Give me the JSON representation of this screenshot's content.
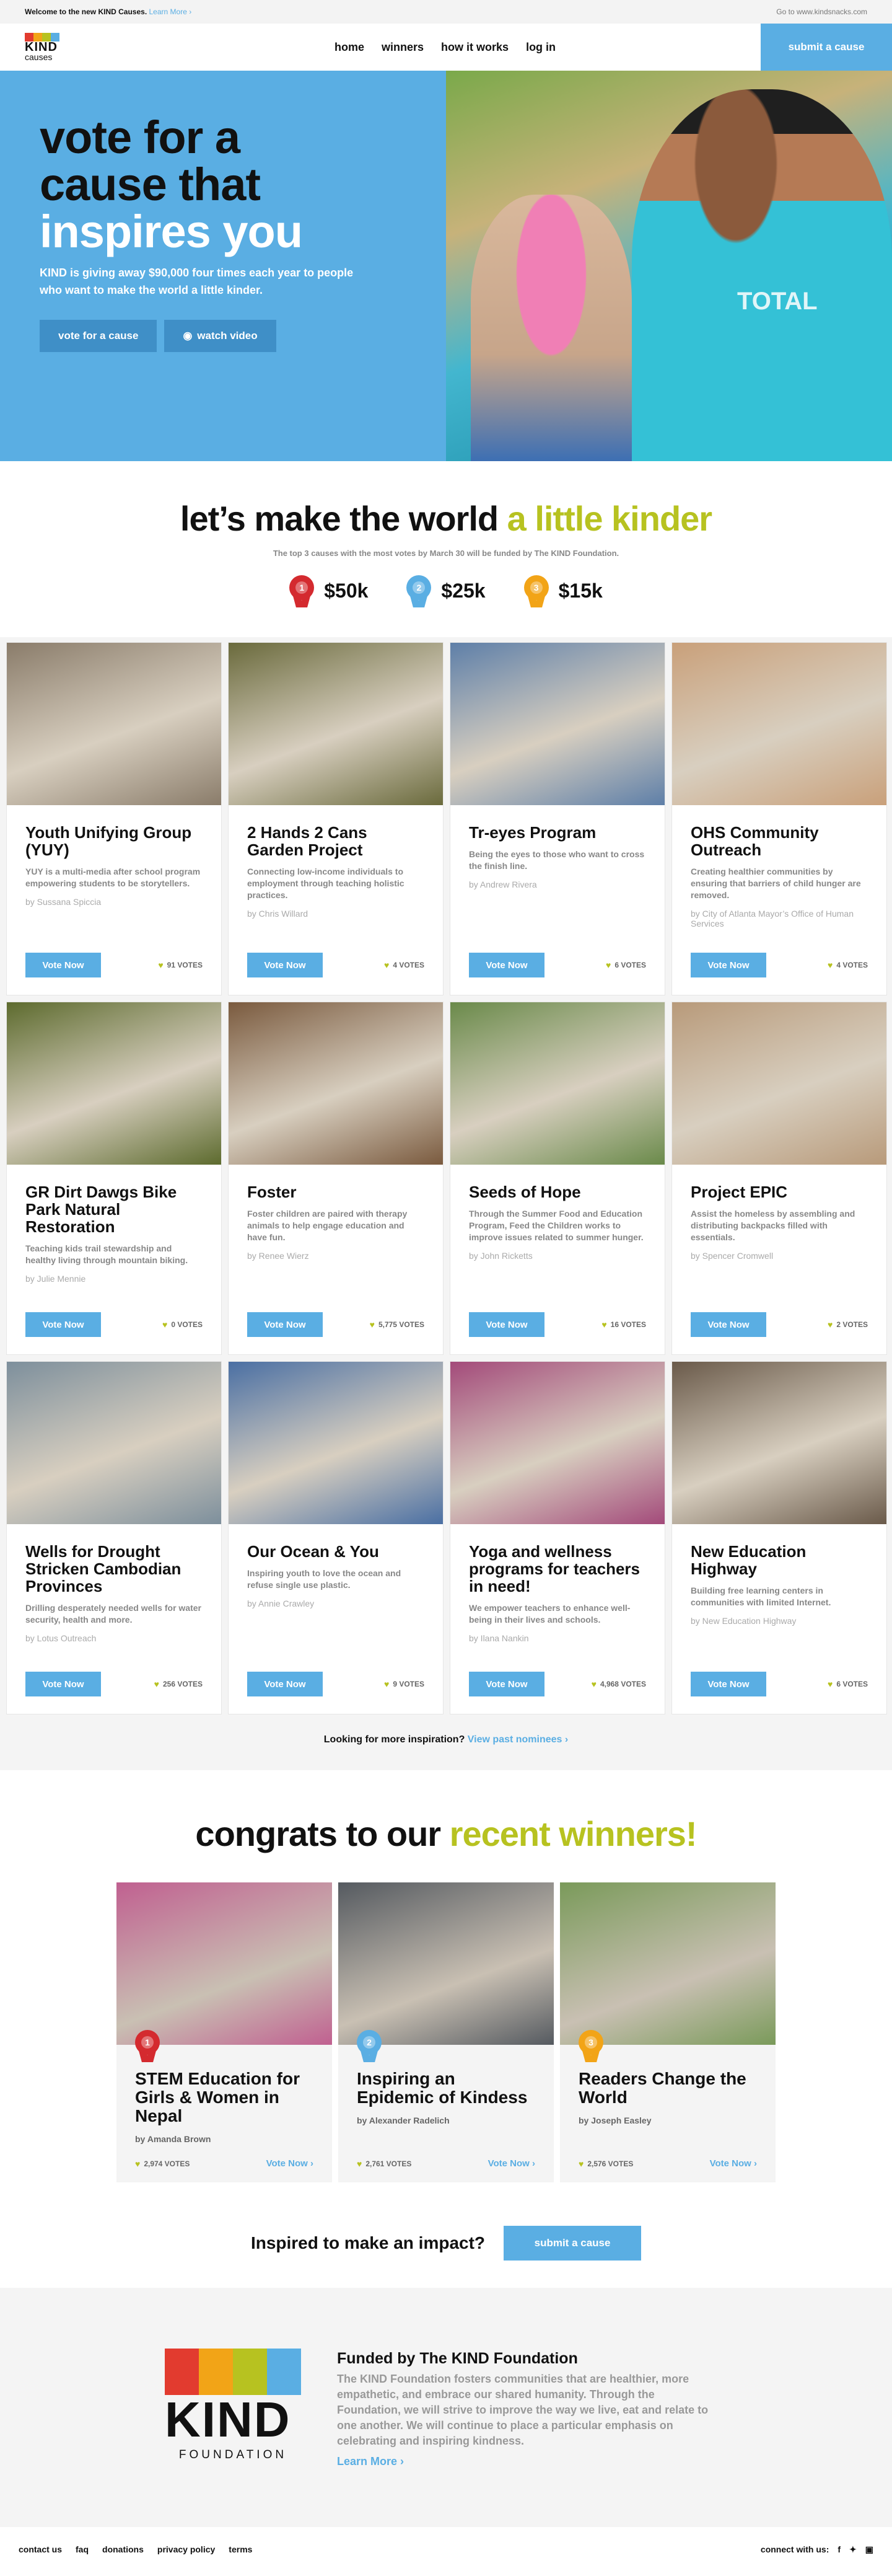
{
  "topbar": {
    "welcome": "Welcome to the new KIND Causes.",
    "learn_more": "Learn More ›",
    "goto": "Go to www.kindsnacks.com"
  },
  "logo": {
    "word": "KIND",
    "sub": "causes"
  },
  "nav": {
    "items": [
      "home",
      "winners",
      "how it works",
      "log in"
    ],
    "cta": "submit a cause"
  },
  "hero": {
    "line1": "vote for a",
    "line2": "cause that",
    "line3": "inspires you",
    "body": "KIND is giving away $90,000 four times each year to people who want to make the world a little kinder.",
    "btn_vote": "vote for a cause",
    "btn_video": "watch video",
    "shirt_text": "TOTAL"
  },
  "kinder": {
    "title_a": "let’s make the world",
    "title_b": "a little kinder",
    "sub": "The top 3 causes with the most votes by March 30 will be funded by The KIND Foundation.",
    "prizes": [
      {
        "rank": "1",
        "amount": "$50k",
        "color": "#d42a2f"
      },
      {
        "rank": "2",
        "amount": "$25k",
        "color": "#5aaee3"
      },
      {
        "rank": "3",
        "amount": "$15k",
        "color": "#f2a417"
      }
    ]
  },
  "causes": [
    {
      "title": "Youth Unifying Group (YUY)",
      "desc": "YUY is a multi-media after school program empowering students to be storytellers.",
      "by": "by Sussana Spiccia",
      "votes": "91 VOTES",
      "img": "#8a7c6a"
    },
    {
      "title": "2 Hands 2 Cans Garden Project",
      "desc": "Connecting low-income individuals to employment through teaching holistic practices.",
      "by": "by Chris Willard",
      "votes": "4 VOTES",
      "img": "#6a6a3c"
    },
    {
      "title": "Tr-eyes Program",
      "desc": "Being the eyes to those who want to cross the finish line.",
      "by": "by Andrew Rivera",
      "votes": "6 VOTES",
      "img": "#5e7fa8"
    },
    {
      "title": "OHS Community Outreach",
      "desc": "Creating healthier communities by ensuring that barriers of child hunger are removed.",
      "by": "by City of Atlanta Mayor’s Office of Human Services",
      "votes": "4 VOTES",
      "img": "#c9a07a"
    },
    {
      "title": "GR Dirt Dawgs Bike Park Natural Restoration",
      "desc": "Teaching kids trail stewardship and healthy living through mountain biking.",
      "by": "by Julie Mennie",
      "votes": "0 VOTES",
      "img": "#5d6b2e"
    },
    {
      "title": "Foster",
      "desc": "Foster children are paired with therapy animals to help engage education and have fun.",
      "by": "by Renee Wierz",
      "votes": "5,775 VOTES",
      "img": "#7a5a3e"
    },
    {
      "title": "Seeds of Hope",
      "desc": "Through the Summer Food and Education Program, Feed the Children works to improve issues related to summer hunger.",
      "by": "by John Ricketts",
      "votes": "16 VOTES",
      "img": "#6a8a4a"
    },
    {
      "title": "Project EPIC",
      "desc": "Assist the homeless by assembling and distributing backpacks filled with essentials.",
      "by": "by Spencer Cromwell",
      "votes": "2 VOTES",
      "img": "#b89a7a"
    },
    {
      "title": "Wells for Drought Stricken Cambodian Provinces",
      "desc": "Drilling desperately needed wells for water security, health and more.",
      "by": "by Lotus Outreach",
      "votes": "256 VOTES",
      "img": "#7d8f9c"
    },
    {
      "title": "Our Ocean & You",
      "desc": "Inspiring youth to love the ocean and refuse single use plastic.",
      "by": "by Annie Crawley",
      "votes": "9 VOTES",
      "img": "#4a6fa3"
    },
    {
      "title": "Yoga and wellness programs for teachers in need!",
      "desc": "We empower teachers to enhance well-being in their lives and schools.",
      "by": "by Ilana Nankin",
      "votes": "4,968 VOTES",
      "img": "#a34a7a"
    },
    {
      "title": "New Education Highway",
      "desc": "Building free learning centers in communities with limited Internet.",
      "by": "by New Education Highway",
      "votes": "6 VOTES",
      "img": "#6a5a4a"
    }
  ],
  "vote_label": "Vote Now",
  "more": {
    "q": "Looking for more inspiration?",
    "link": "View past nominees ›"
  },
  "winners": {
    "title_a": "congrats to our",
    "title_b": "recent winners!",
    "items": [
      {
        "rank": "1",
        "color": "#d42a2f",
        "title": "STEM Education for Girls & Women in Nepal",
        "by": "by Amanda Brown",
        "votes": "2,974 VOTES",
        "img": "#c06090"
      },
      {
        "rank": "2",
        "color": "#5aaee3",
        "title": "Inspiring an Epidemic of Kindess",
        "by": "by Alexander Radelich",
        "votes": "2,761 VOTES",
        "img": "#555a60"
      },
      {
        "rank": "3",
        "color": "#f2a417",
        "title": "Readers Change the World",
        "by": "by Joseph Easley",
        "votes": "2,576 VOTES",
        "img": "#7a9a5a"
      }
    ],
    "vote_link": "Vote Now ›"
  },
  "inspire": {
    "q": "Inspired to make an impact?",
    "btn": "submit a cause"
  },
  "foundation": {
    "word": "KIND",
    "sub": "FOUNDATION",
    "title": "Funded by The KIND Foundation",
    "body": "The KIND Foundation fosters communities that are healthier, more empathetic, and embrace our shared humanity. Through the Foundation, we will strive to improve the way we live, eat and relate to one another. We will continue to place a particular emphasis on celebrating and inspiring kindness.",
    "link": "Learn More ›"
  },
  "footer": {
    "links": [
      "contact us",
      "faq",
      "donations",
      "privacy policy",
      "terms"
    ],
    "connect": "connect with us:"
  },
  "colors": {
    "blue": "#5aaee3",
    "green": "#b7c220"
  }
}
